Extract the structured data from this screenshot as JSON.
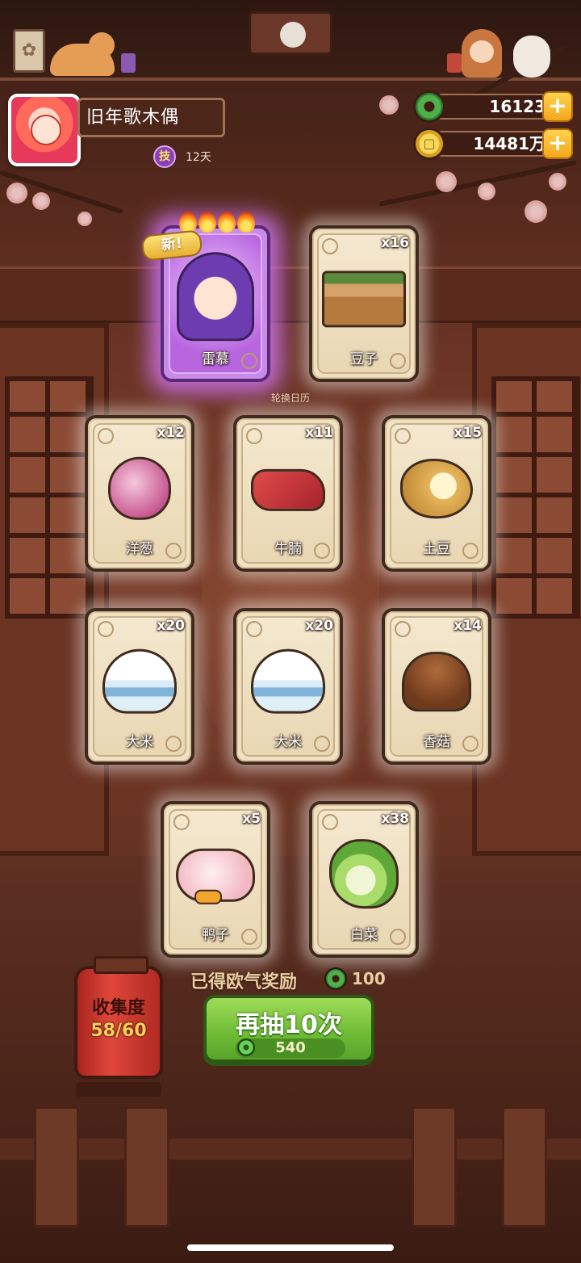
{
  "player": {
    "name": "旧年歌木偶",
    "skill_badge": "技",
    "days": "12天"
  },
  "currency": {
    "jade": "16123",
    "coins": "14481万",
    "add_label": "+"
  },
  "banner": {
    "new_tag": "新!",
    "calendar_label": "轮换日历"
  },
  "cards": [
    {
      "label": "雷慕",
      "count": "",
      "rarity": "rare",
      "icon": "character-portrait"
    },
    {
      "label": "豆子",
      "count": "x16",
      "icon": "bean-box-icon"
    },
    {
      "label": "洋葱",
      "count": "x12",
      "icon": "onion-icon"
    },
    {
      "label": "牛腩",
      "count": "x11",
      "icon": "beef-icon"
    },
    {
      "label": "土豆",
      "count": "x15",
      "icon": "potato-icon"
    },
    {
      "label": "大米",
      "count": "x20",
      "icon": "rice-bowl-icon"
    },
    {
      "label": "大米",
      "count": "x20",
      "icon": "rice-bowl-icon"
    },
    {
      "label": "香菇",
      "count": "x14",
      "icon": "mushroom-icon"
    },
    {
      "label": "鸭子",
      "count": "x5",
      "icon": "duck-icon"
    },
    {
      "label": "白菜",
      "count": "x38",
      "icon": "cabbage-icon"
    }
  ],
  "bonus": {
    "text": "已得欧气奖励",
    "value": "100"
  },
  "collection": {
    "label": "收集度",
    "value": "58/60"
  },
  "draw_button": {
    "label": "再抽10次",
    "cost": "540"
  },
  "colors": {
    "rare_glow": "#d678ff",
    "button_green": "#6dbb35",
    "lantern_red": "#e0463a"
  }
}
